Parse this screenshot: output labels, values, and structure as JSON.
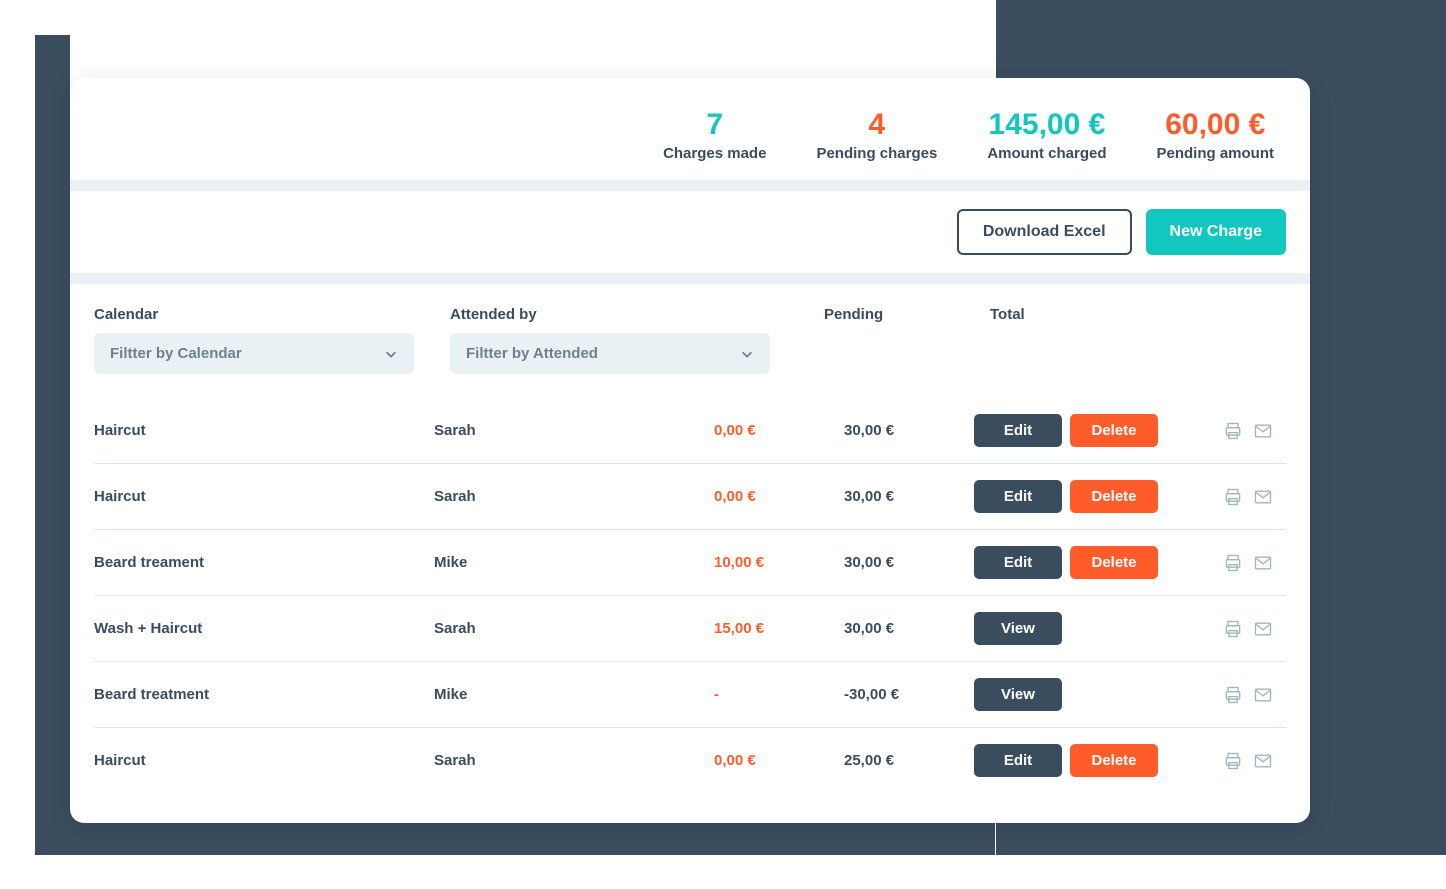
{
  "stats": {
    "charges_made": {
      "value": "7",
      "label": "Charges made"
    },
    "pending_charges": {
      "value": "4",
      "label": "Pending charges"
    },
    "amount_charged": {
      "value": "145,00 €",
      "label": "Amount charged"
    },
    "pending_amount": {
      "value": "60,00 €",
      "label": "Pending amount"
    }
  },
  "actions": {
    "download_excel": "Download Excel",
    "new_charge": "New Charge"
  },
  "filters": {
    "calendar": {
      "label": "Calendar",
      "placeholder": "Filtter by Calendar"
    },
    "attended": {
      "label": "Attended by",
      "placeholder": "Filtter by Attended"
    },
    "pending_header": "Pending",
    "total_header": "Total"
  },
  "buttons": {
    "edit": "Edit",
    "delete": "Delete",
    "view": "View"
  },
  "rows": [
    {
      "service": "Haircut",
      "attended": "Sarah",
      "pending": "0,00 €",
      "total": "30,00 €",
      "mode": "edit"
    },
    {
      "service": "Haircut",
      "attended": "Sarah",
      "pending": "0,00 €",
      "total": "30,00 €",
      "mode": "edit"
    },
    {
      "service": "Beard treament",
      "attended": "Mike",
      "pending": "10,00 €",
      "total": "30,00 €",
      "mode": "edit"
    },
    {
      "service": "Wash + Haircut",
      "attended": "Sarah",
      "pending": "15,00 €",
      "total": "30,00 €",
      "mode": "view"
    },
    {
      "service": "Beard treatment",
      "attended": "Mike",
      "pending": "-",
      "total": "-30,00 €",
      "mode": "view"
    },
    {
      "service": "Haircut",
      "attended": "Sarah",
      "pending": "0,00 €",
      "total": "25,00 €",
      "mode": "edit"
    }
  ]
}
